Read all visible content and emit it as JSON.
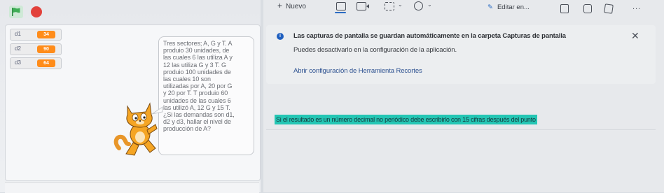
{
  "stage": {
    "monitors": [
      {
        "label": "d1",
        "value": "34"
      },
      {
        "label": "d2",
        "value": "90"
      },
      {
        "label": "d3",
        "value": "64"
      }
    ],
    "speech_text": "Tres sectores; A, G y T. A\nproduio 30 unidades, de\nlas cuales 6 las utiliza A y\n12 las utiliza G y 3 T. G\nproduio 100 unidades de\nlas cuales 10 son\nutilizadas por A, 20 por G\ny 20 por T. T produio 60\nunidades de las cuales 6\nlas utilizó A, 12 G y 15 T.\n¿Si las demandas son d1,\nd2 y d3, hallar el nivel de\nproducción de A?",
    "colors": {
      "flag": "#3fae56",
      "stop": "#e2413b",
      "monitor_value": "#ff8c1a"
    }
  },
  "snipping_tool": {
    "toolbar": {
      "new_label": "Nuevo",
      "edit_label": "Editar en...",
      "more_label": "..."
    },
    "notification": {
      "title": "Las capturas de pantalla se guardan automáticamente en la carpeta Capturas de pantalla",
      "body": "Puedes desactivarlo en la configuración de la aplicación.",
      "close": "✕",
      "link": "Abrir configuración de Herramienta Recortes"
    },
    "highlighted_text": "Si el resultado es un número decimal no periódico debe escribirlo con 15 cifras después del punto",
    "colors": {
      "highlight": "#24c6b4",
      "accent": "#2b6cc4"
    }
  }
}
